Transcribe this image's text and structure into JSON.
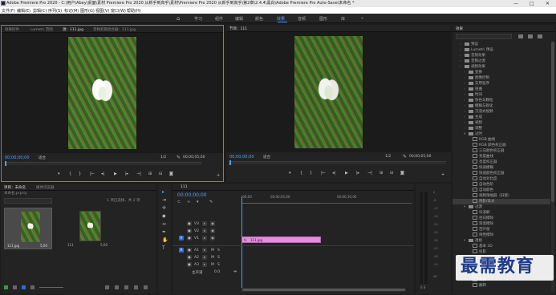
{
  "window": {
    "title": "Adobe Premiere Pro 2020 - C:\\用户\\Abey\\桌面\\素材 Premiere Pro 2020 从新手到高手\\素材\\Premiere Pro 2020 从新手到高手\\第2章\\2.4.4\\黑白\\Adobe Premiere Pro Auto-Save\\未命名 *",
    "minimize": "—",
    "maximize": "□",
    "close": "✕"
  },
  "menu": [
    "文件(F)",
    "编辑(E)",
    "剪辑(C)",
    "序列(S)",
    "标记(M)",
    "图形(G)",
    "视图(V)",
    "窗口(W)",
    "帮助(H)"
  ],
  "workspaces": {
    "home": "⌂",
    "items": [
      "学习",
      "组件",
      "编辑",
      "颜色",
      "效果",
      "音频",
      "图形",
      "库"
    ],
    "active": "效果",
    "more": "»"
  },
  "source_panel": {
    "tabs": [
      "效果控件",
      "Lumetri 范围",
      "源：111.jpg",
      "音频剪辑混合器：111.jpg"
    ],
    "active_tab": "源：111.jpg",
    "timecode_left": "00;00;00;00",
    "fit": "适合",
    "fraction": "1/2",
    "timecode_right": "00;00;05;00"
  },
  "program_panel": {
    "tab": "节目：111",
    "timecode_left": "00;00;00;00",
    "fit": "适合",
    "fraction": "1/2",
    "timecode_right": "00;00;05;00"
  },
  "transport": [
    "▾",
    "{",
    "}",
    "|←",
    "◂|",
    "▶",
    "|▸",
    "→|",
    "⊞",
    "⊟",
    "◙",
    "+"
  ],
  "project_panel": {
    "tabs": [
      "项目：未命名",
      "媒体浏览器"
    ],
    "project_file": "未命名.prproj",
    "selection": "1 项已选择，共 2 项",
    "items": [
      {
        "name": "111.jpg",
        "duration": "5;00"
      },
      {
        "name": "111",
        "duration": "5;00"
      }
    ]
  },
  "timeline": {
    "tab": "111",
    "timecode": "00;00;00;00",
    "ruler": [
      ":00;00",
      "00;00;05;00",
      "00;00;10;00"
    ],
    "video_tracks": [
      "V3",
      "V2",
      "V1"
    ],
    "audio_tracks": [
      "A1",
      "A2",
      "A3"
    ],
    "master": "主声道",
    "master_value": "0.0",
    "clip_label": "111.jpg"
  },
  "audio_meter": {
    "labels": [
      "0",
      "-6",
      "-12",
      "-18",
      "-24",
      "-30",
      "-36",
      "-42",
      "-48",
      "-54",
      "dB"
    ],
    "solo": "S S"
  },
  "effects_panel": {
    "title": "效果",
    "search_placeholder": "",
    "items": [
      {
        "indent": 1,
        "type": "folder",
        "label": "预设"
      },
      {
        "indent": 1,
        "type": "folder",
        "label": "Lumetri 预设"
      },
      {
        "indent": 1,
        "type": "folder",
        "label": "音频效果"
      },
      {
        "indent": 1,
        "type": "folder",
        "label": "音频过渡"
      },
      {
        "indent": 1,
        "type": "folder",
        "label": "视频效果"
      },
      {
        "indent": 2,
        "type": "folder",
        "label": "变换"
      },
      {
        "indent": 2,
        "type": "folder",
        "label": "图像控制"
      },
      {
        "indent": 2,
        "type": "folder",
        "label": "实用程序"
      },
      {
        "indent": 2,
        "type": "folder",
        "label": "扭曲"
      },
      {
        "indent": 2,
        "type": "folder",
        "label": "时间"
      },
      {
        "indent": 2,
        "type": "folder",
        "label": "杂色与颗粒"
      },
      {
        "indent": 2,
        "type": "folder",
        "label": "模糊与锐化"
      },
      {
        "indent": 2,
        "type": "folder",
        "label": "沉浸式视频"
      },
      {
        "indent": 2,
        "type": "folder",
        "label": "生成"
      },
      {
        "indent": 2,
        "type": "folder",
        "label": "视频"
      },
      {
        "indent": 2,
        "type": "folder",
        "label": "调整"
      },
      {
        "indent": 2,
        "type": "folder",
        "label": "过时",
        "open": true
      },
      {
        "indent": 3,
        "type": "fx",
        "label": "RGB 曲线"
      },
      {
        "indent": 3,
        "type": "fx",
        "label": "RGB 颜色校正器"
      },
      {
        "indent": 3,
        "type": "fx",
        "label": "三向颜色校正器"
      },
      {
        "indent": 3,
        "type": "fx",
        "label": "亮度曲线"
      },
      {
        "indent": 3,
        "type": "fx",
        "label": "亮度校正器"
      },
      {
        "indent": 3,
        "type": "fx",
        "label": "快速模糊"
      },
      {
        "indent": 3,
        "type": "fx",
        "label": "快速颜色校正器"
      },
      {
        "indent": 3,
        "type": "fx",
        "label": "自动对比度"
      },
      {
        "indent": 3,
        "type": "fx",
        "label": "自动色阶"
      },
      {
        "indent": 3,
        "type": "fx",
        "label": "自动颜色"
      },
      {
        "indent": 3,
        "type": "fx",
        "label": "视频限幅器（旧版）"
      },
      {
        "indent": 3,
        "type": "fx",
        "label": "阴影/高光",
        "selected": true
      },
      {
        "indent": 2,
        "type": "folder",
        "label": "过渡",
        "open": true
      },
      {
        "indent": 3,
        "type": "fx",
        "label": "块溶解"
      },
      {
        "indent": 3,
        "type": "fx",
        "label": "径向擦除"
      },
      {
        "indent": 3,
        "type": "fx",
        "label": "渐变擦除"
      },
      {
        "indent": 3,
        "type": "fx",
        "label": "百叶窗"
      },
      {
        "indent": 3,
        "type": "fx",
        "label": "线性擦除"
      },
      {
        "indent": 2,
        "type": "folder",
        "label": "透视",
        "open": true
      },
      {
        "indent": 3,
        "type": "fx",
        "label": "基本 3D"
      },
      {
        "indent": 3,
        "type": "fx",
        "label": "投影"
      },
      {
        "indent": 3,
        "type": "fx",
        "label": "放射阴影"
      },
      {
        "indent": 3,
        "type": "fx",
        "label": "斜角边"
      },
      {
        "indent": 3,
        "type": "fx",
        "label": "斜面 Alpha"
      },
      {
        "indent": 3,
        "type": "fx",
        "label": "复制"
      },
      {
        "indent": 3,
        "type": "fx",
        "label": "裁剪"
      },
      {
        "indent": 3,
        "type": "fx",
        "label": "翻转"
      }
    ]
  },
  "watermark": {
    "text": "最需教育"
  },
  "colors": {
    "accent": "#4aa3ff",
    "clip": "#e58ee0",
    "panel": "#232323"
  }
}
